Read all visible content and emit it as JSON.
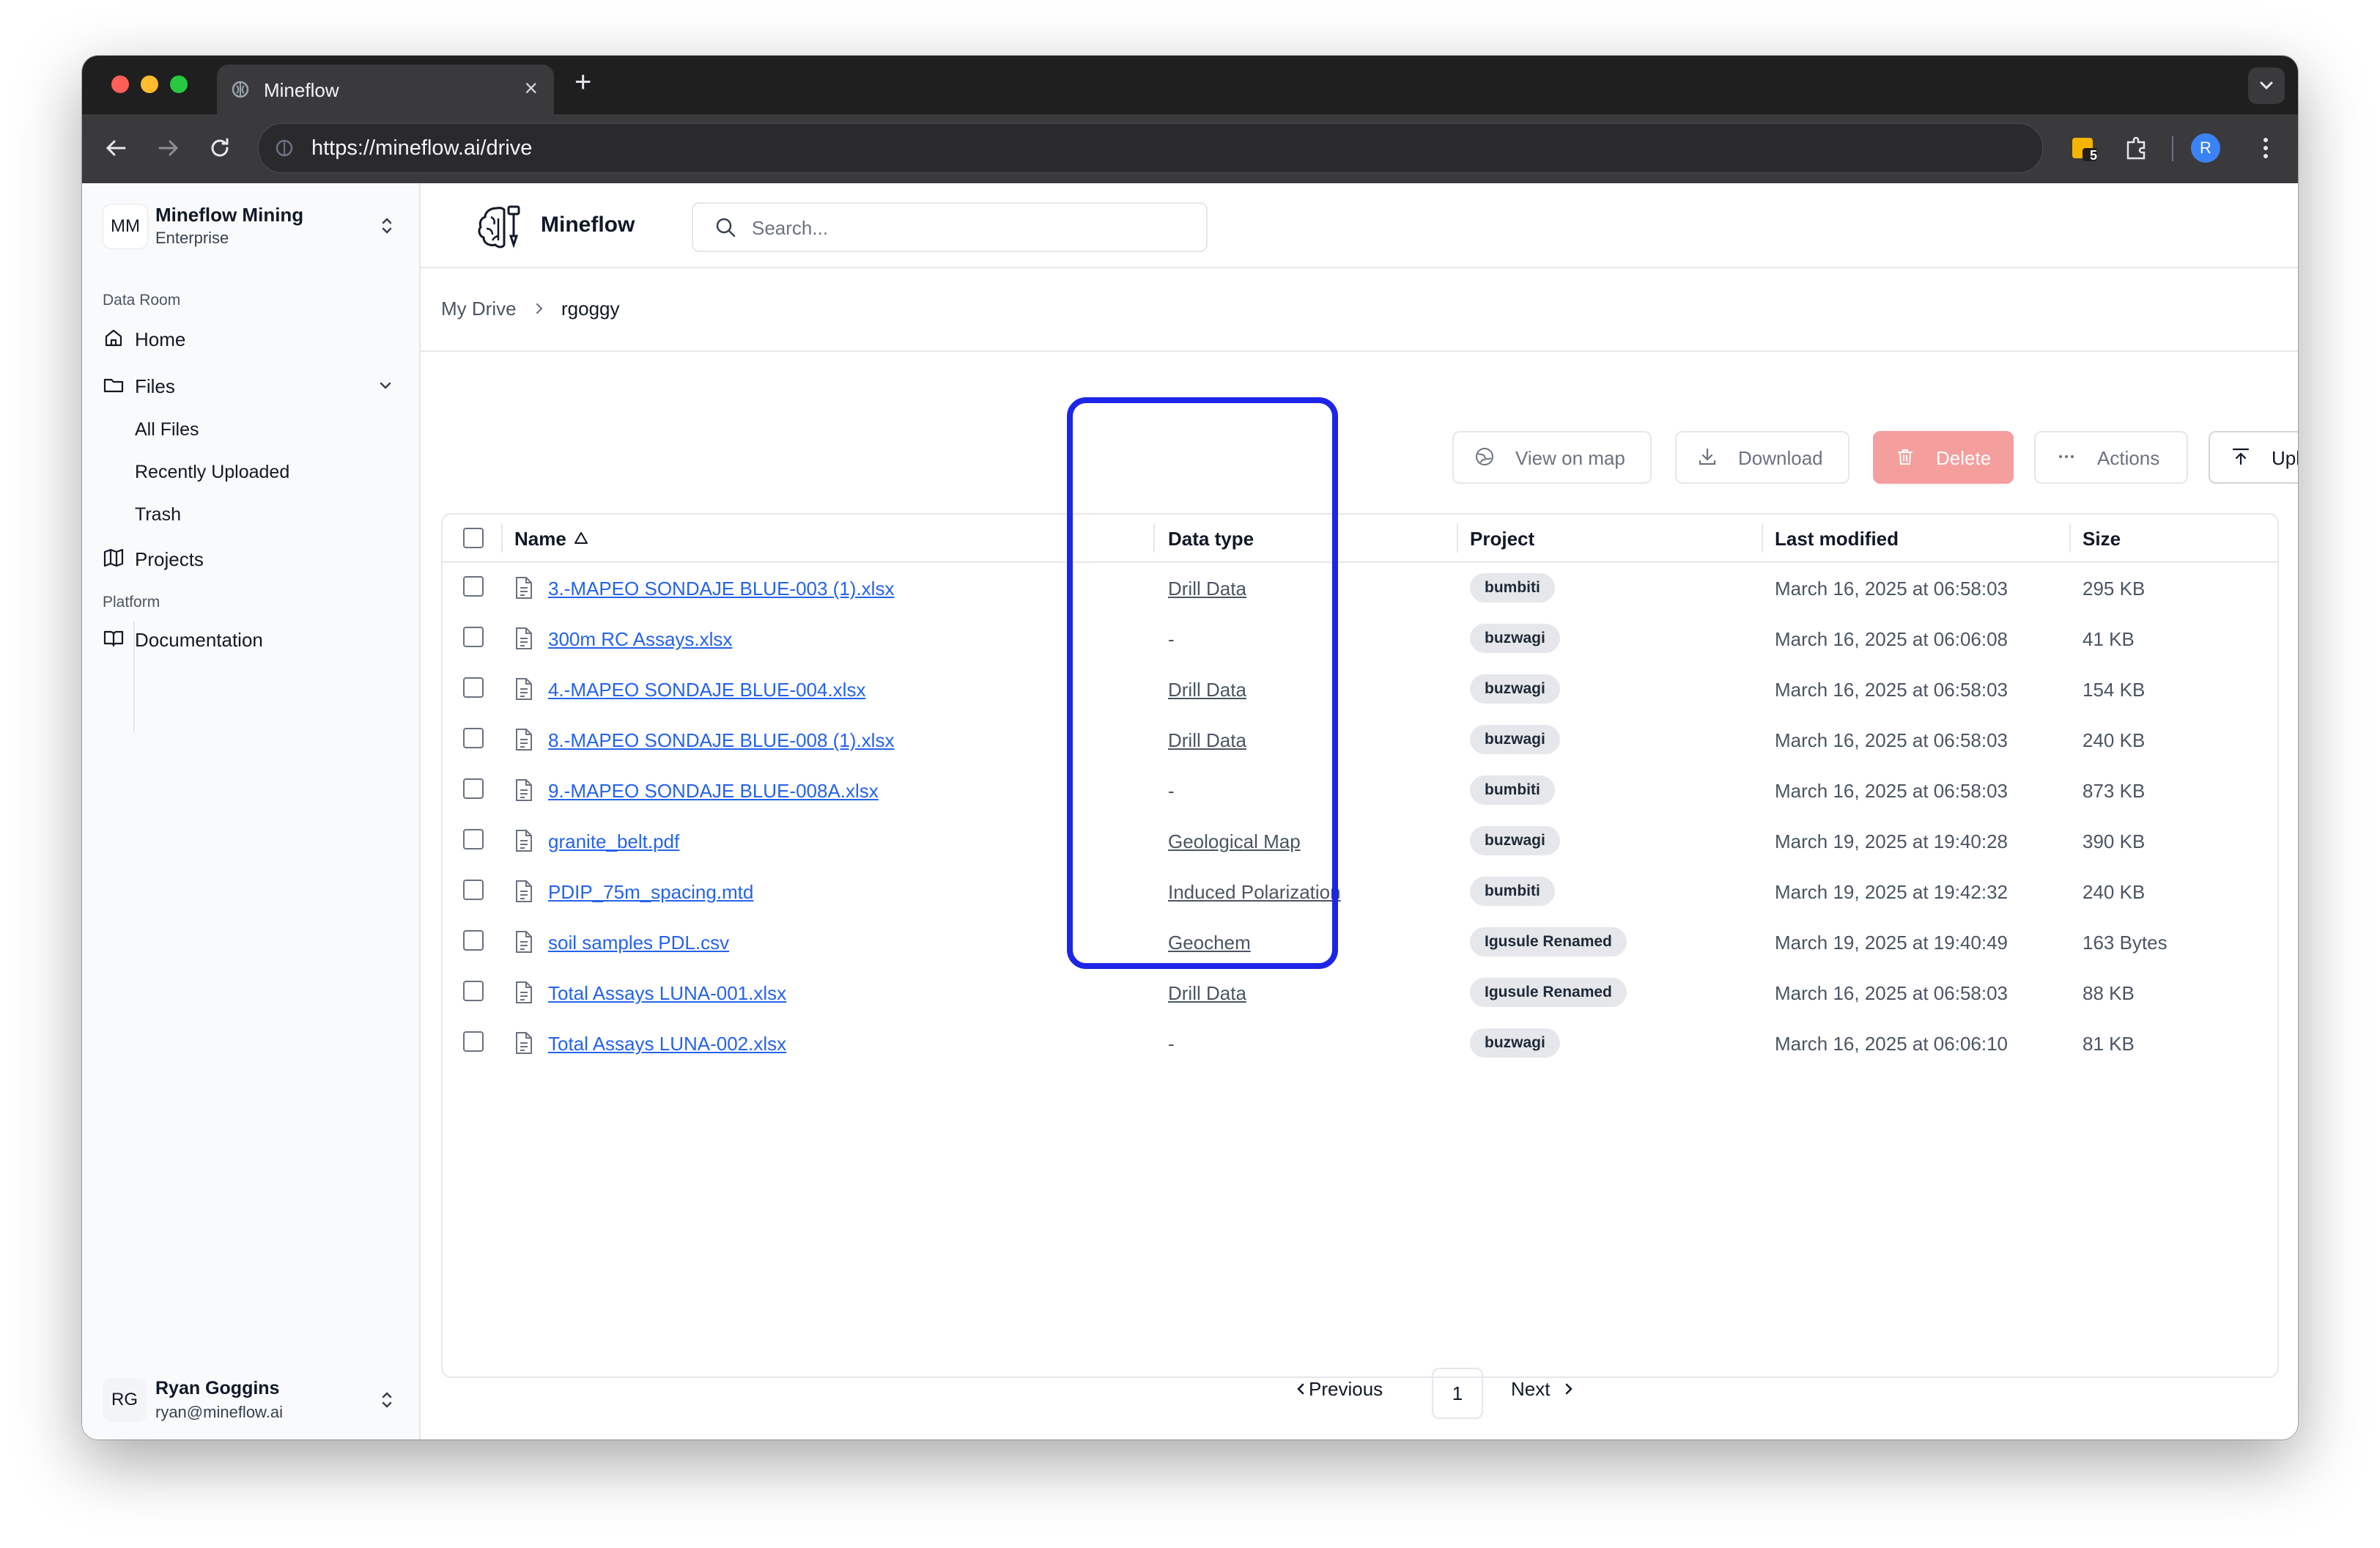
{
  "browser": {
    "tab_title": "Mineflow",
    "new_tab": "+",
    "url": "https://mineflow.ai/drive",
    "extension_badge": "5",
    "profile_initial": "R",
    "colors": {
      "close": "#ff5f57",
      "minimize": "#febc2e",
      "maximize": "#28c840"
    }
  },
  "sidebar": {
    "org_initials": "MM",
    "org_name": "Mineflow Mining",
    "org_plan": "Enterprise",
    "section_data_room": "Data Room",
    "home": "Home",
    "files": "Files",
    "files_children": [
      "All Files",
      "Recently Uploaded",
      "Trash"
    ],
    "projects": "Projects",
    "section_platform": "Platform",
    "documentation": "Documentation",
    "user_initials": "RG",
    "user_name": "Ryan Goggins",
    "user_email": "ryan@mineflow.ai"
  },
  "header": {
    "brand": "Mineflow",
    "search_placeholder": "Search..."
  },
  "breadcrumb": [
    "My Drive",
    "rgoggy"
  ],
  "actions": {
    "view_on_map": "View on map",
    "download": "Download",
    "delete": "Delete",
    "actions": "Actions",
    "upload": "Upload"
  },
  "table": {
    "columns": [
      "Name",
      "Data type",
      "Project",
      "Last modified",
      "Size"
    ],
    "rows": [
      {
        "name": "3.-MAPEO SONDAJE BLUE-003 (1).xlsx",
        "data_type": "Drill Data",
        "project": "bumbiti",
        "modified": "March 16, 2025 at 06:58:03",
        "size": "295 KB"
      },
      {
        "name": "300m RC Assays.xlsx",
        "data_type": "-",
        "project": "buzwagi",
        "modified": "March 16, 2025 at 06:06:08",
        "size": "41 KB"
      },
      {
        "name": "4.-MAPEO SONDAJE BLUE-004.xlsx",
        "data_type": "Drill Data",
        "project": "buzwagi",
        "modified": "March 16, 2025 at 06:58:03",
        "size": "154 KB"
      },
      {
        "name": "8.-MAPEO SONDAJE BLUE-008 (1).xlsx",
        "data_type": "Drill Data",
        "project": "buzwagi",
        "modified": "March 16, 2025 at 06:58:03",
        "size": "240 KB"
      },
      {
        "name": "9.-MAPEO SONDAJE BLUE-008A.xlsx",
        "data_type": "-",
        "project": "bumbiti",
        "modified": "March 16, 2025 at 06:58:03",
        "size": "873 KB"
      },
      {
        "name": "granite_belt.pdf",
        "data_type": "Geological Map",
        "project": "buzwagi",
        "modified": "March 19, 2025 at 19:40:28",
        "size": "390 KB"
      },
      {
        "name": "PDIP_75m_spacing.mtd",
        "data_type": "Induced Polarization",
        "project": "bumbiti",
        "modified": "March 19, 2025 at 19:42:32",
        "size": "240 KB"
      },
      {
        "name": "soil samples PDL.csv",
        "data_type": "Geochem",
        "project": "Igusule Renamed",
        "modified": "March 19, 2025 at 19:40:49",
        "size": "163 Bytes"
      },
      {
        "name": "Total Assays LUNA-001.xlsx",
        "data_type": "Drill Data",
        "project": "Igusule Renamed",
        "modified": "March 16, 2025 at 06:58:03",
        "size": "88 KB"
      },
      {
        "name": "Total Assays LUNA-002.xlsx",
        "data_type": "-",
        "project": "buzwagi",
        "modified": "March 16, 2025 at 06:06:10",
        "size": "81 KB"
      }
    ]
  },
  "pagination": {
    "previous": "Previous",
    "page": "1",
    "next": "Next"
  },
  "accent_colors": {
    "link": "#2563eb",
    "delete": "#f59e9e",
    "highlight": "#1d26e6"
  }
}
